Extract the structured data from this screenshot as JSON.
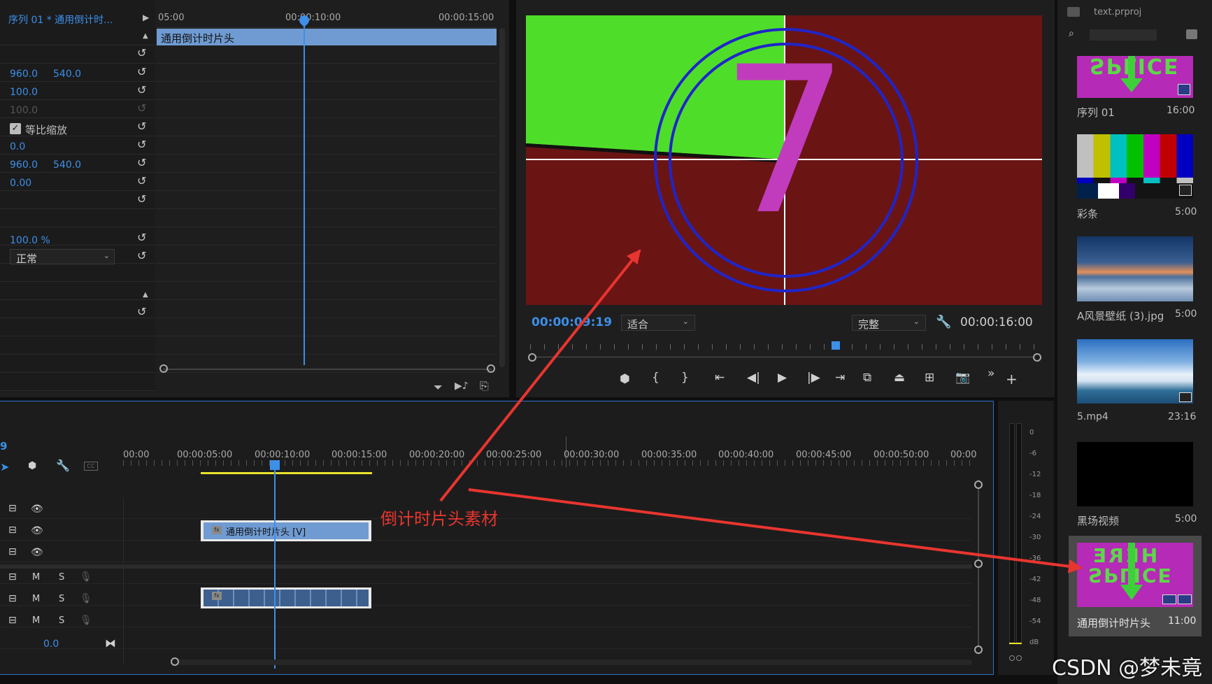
{
  "effect_controls": {
    "title": "序列 01 * 通用倒计时...",
    "ruler": [
      "05:00",
      "00:00:10:00",
      "00:00:15:00"
    ],
    "clip_label": "通用倒计时片头",
    "pos_x": "960.0",
    "pos_y": "540.0",
    "scale": "100.0",
    "scale_width": "100.0",
    "uniform_scale_label": "等比缩放",
    "rotation": "0.0",
    "anchor_x": "960.0",
    "anchor_y": "540.0",
    "anti_flicker": "0.00",
    "opacity": "100.0 %",
    "blend_mode": "正常"
  },
  "program_monitor": {
    "countdown_digit": "7",
    "timecode": "00:00:09:19",
    "fit_label": "适合",
    "quality_label": "完整",
    "duration": "00:00:16:00"
  },
  "project": {
    "file_name": "text.prproj",
    "items": [
      {
        "name": "序列 01",
        "duration": "16:00",
        "thumb_text": "SPLICE"
      },
      {
        "name": "彩条",
        "duration": "5:00"
      },
      {
        "name": "A风景壁纸 (3).jpg",
        "duration": "5:00"
      },
      {
        "name": "5.mp4",
        "duration": "23:16"
      },
      {
        "name": "黑场视频",
        "duration": "5:00"
      },
      {
        "name": "通用倒计时片头",
        "duration": "11:00",
        "thumb_text_top": "HERE",
        "thumb_text_bottom": "SPLICE"
      }
    ]
  },
  "timeline": {
    "marker_num": "9",
    "ruler": [
      "00:00",
      "00:00:05:00",
      "00:00:10:00",
      "00:00:15:00",
      "00:00:20:00",
      "00:00:25:00",
      "00:00:30:00",
      "00:00:35:00",
      "00:00:40:00",
      "00:00:45:00",
      "00:00:50:00",
      "00:00"
    ],
    "video_clip_label": "通用倒计时片头 [V]",
    "track_m": "M",
    "track_s": "S",
    "master_vol": "0.0"
  },
  "audio_meter": {
    "labels": [
      "0",
      "-6",
      "-12",
      "-18",
      "-24",
      "-30",
      "-36",
      "-42",
      "-48",
      "-54",
      "dB"
    ]
  },
  "annotation": {
    "text": "倒计时片头素材",
    "color": "#e8352f"
  },
  "watermark": "CSDN @梦未竟"
}
